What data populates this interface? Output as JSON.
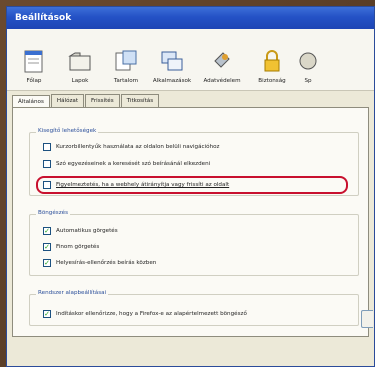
{
  "window": {
    "title": "Beállítások"
  },
  "toolbar": {
    "items": [
      {
        "label": "Főlap",
        "icon": "home-page-icon"
      },
      {
        "label": "Lapok",
        "icon": "tabs-icon"
      },
      {
        "label": "Tartalom",
        "icon": "content-icon"
      },
      {
        "label": "Alkalmazások",
        "icon": "applications-icon"
      },
      {
        "label": "Adatvédelem",
        "icon": "privacy-icon"
      },
      {
        "label": "Biztonság",
        "icon": "security-lock-icon"
      },
      {
        "label": "Sp",
        "icon": "advanced-icon"
      }
    ]
  },
  "tabs": [
    {
      "label": "Általános",
      "active": true
    },
    {
      "label": "Hálózat",
      "active": false
    },
    {
      "label": "Frissítés",
      "active": false
    },
    {
      "label": "Titkosítás",
      "active": false
    }
  ],
  "accessibility_group": {
    "legend": "Kisegítő lehetőségek",
    "options": [
      {
        "label": "Kurzorbillentyűk használata az oldalon belüli navigációhoz",
        "checked": false
      },
      {
        "label": "Szó egyezéseinek a keresését szó beírásánál elkezdeni",
        "checked": false
      },
      {
        "label": "Figyelmeztetés, ha a webhely átirányítja vagy frissíti az oldalt",
        "checked": false,
        "highlighted": true
      }
    ]
  },
  "browsing_group": {
    "legend": "Böngészés",
    "options": [
      {
        "label": "Automatikus görgetés",
        "checked": true
      },
      {
        "label": "Finom görgetés",
        "checked": true
      },
      {
        "label": "Helyesírás-ellenőrzés beírás közben",
        "checked": true
      }
    ]
  },
  "default_browser_group": {
    "legend": "Rendszer alapbeállításai",
    "options": [
      {
        "label": "Indításkor ellenőrizze, hogy a Firefox-e az alapértelmezett böngésző",
        "checked": true
      }
    ]
  },
  "colors": {
    "highlight": "#c8102e",
    "titlebar": "#2452c6",
    "check": "#21a121"
  }
}
